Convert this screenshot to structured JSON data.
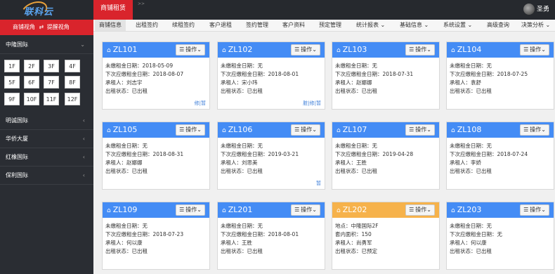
{
  "app": {
    "brand": "联科云"
  },
  "header": {
    "active_tab": "商铺租赁",
    "crumbs": ">>",
    "user": "圣勇"
  },
  "nav": {
    "items": [
      "商铺信息",
      "出租签约",
      "续租签约",
      "客户退租",
      "签约管理",
      "客户资料",
      "预定管理",
      "统计报表 ⌄",
      "基础信息 ⌄",
      "系统设置 ⌄",
      "高级查询",
      "决策分析 ⌄"
    ]
  },
  "sidebar": {
    "head_left": "商铺视角",
    "head_right": "提醒视角",
    "groups": [
      {
        "label": "中隆国际",
        "chev": "⌄"
      },
      {
        "label": "明诚国际",
        "chev": "‹"
      },
      {
        "label": "华侨大厦",
        "chev": "‹"
      },
      {
        "label": "红橡国际",
        "chev": "‹"
      },
      {
        "label": "保利国际",
        "chev": "‹"
      }
    ],
    "floors": [
      "1F",
      "2F",
      "3F",
      "4F",
      "5F",
      "6F",
      "7F",
      "8F",
      "9F",
      "10F",
      "11F",
      "12F"
    ]
  },
  "cards": [
    {
      "code": "ZL101",
      "op": "操作",
      "lines": [
        "未缴租金日期：2018-05-09",
        "下次应缴租金日期：2018-08-07",
        "承租人：刘志宇",
        "出租状态：已出租"
      ],
      "links": "修|暂"
    },
    {
      "code": "ZL102",
      "op": "操作",
      "lines": [
        "未缴租金日期：无",
        "下次应缴租金日期：2018-08-01",
        "承租人：宋小玮",
        "出租状态：已出租"
      ],
      "links": "脏|修|暂"
    },
    {
      "code": "ZL103",
      "op": "操作",
      "lines": [
        "未缴租金日期：无",
        "下次应缴租金日期：2018-07-31",
        "承租人：赵娜娜",
        "出租状态：已出租"
      ],
      "links": ""
    },
    {
      "code": "ZL104",
      "op": "操作",
      "lines": [
        "未缴租金日期：无",
        "下次应缴租金日期：2018-07-25",
        "承租人：袁舒",
        "出租状态：已出租"
      ],
      "links": ""
    },
    {
      "code": "ZL105",
      "op": "操作",
      "lines": [
        "未缴租金日期：无",
        "下次应缴租金日期：2018-08-31",
        "承租人：赵娜娜",
        "出租状态：已出租"
      ],
      "links": ""
    },
    {
      "code": "ZL106",
      "op": "操作",
      "lines": [
        "未缴租金日期：无",
        "下次应缴租金日期：2019-03-21",
        "承租人：刘思美",
        "出租状态：已出租"
      ],
      "links": "暂"
    },
    {
      "code": "ZL107",
      "op": "操作",
      "lines": [
        "未缴租金日期：无",
        "下次应缴租金日期：2019-04-28",
        "承租人：王胜",
        "出租状态：已出租"
      ],
      "links": ""
    },
    {
      "code": "ZL108",
      "op": "操作",
      "lines": [
        "未缴租金日期：无",
        "下次应缴租金日期：2018-07-24",
        "承租人：李娇",
        "出租状态：已出租"
      ],
      "links": ""
    },
    {
      "code": "ZL109",
      "op": "操作",
      "lines": [
        "未缴租金日期：无",
        "下次应缴租金日期：2018-07-23",
        "承租人：何以康",
        "出租状态：已出租"
      ],
      "links": ""
    },
    {
      "code": "ZL201",
      "op": "操作",
      "lines": [
        "未缴租金日期：无",
        "下次应缴租金日期：2018-08-01",
        "承租人：王胜",
        "出租状态：已出租"
      ],
      "links": ""
    },
    {
      "code": "ZL202",
      "op": "操作",
      "lines": [
        "地点：中隆国际2F",
        "套内面积：150",
        "承租人：尚勇军",
        "出租状态：已预定"
      ],
      "links": ""
    },
    {
      "code": "ZL203",
      "op": "操作",
      "lines": [
        "未缴租金日期：无",
        "下次应缴租金日期：无",
        "承租人：何以康",
        "出租状态：已出租"
      ],
      "links": ""
    }
  ],
  "colors": {
    "header_dark": "#26292e",
    "accent_red": "#d9242c",
    "card_blue": "#448cf5",
    "card_orange": "#f6b24b",
    "sidebar": "#2a2d33"
  }
}
